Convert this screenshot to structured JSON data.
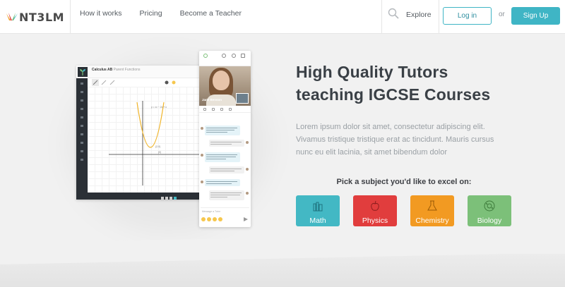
{
  "brand": {
    "logo_text": "NT3LM"
  },
  "nav": {
    "how_it_works": "How it works",
    "pricing": "Pricing",
    "become_teacher": "Become a Teacher"
  },
  "header_right": {
    "explore": "Explore",
    "login": "Log in",
    "or": "or",
    "signup": "Sign Up"
  },
  "mockup": {
    "whiteboard_title": "Calculus AB",
    "whiteboard_subtitle": "Parent Functions",
    "tutor_name": "Jane Benson",
    "message_placeholder": "Message a Tutor"
  },
  "hero": {
    "headline_line1": "High Quality Tutors",
    "headline_line2": "teaching IGCSE Courses",
    "description": "Lorem ipsum dolor sit amet, consectetur adipiscing elit. Vivamus tristique tristique erat ac tincidunt. Mauris cursus nunc eu elit lacinia, sit amet bibendum dolor",
    "pick_prompt": "Pick a subject you'd like to excel on:"
  },
  "subjects": [
    {
      "label": "Math",
      "color": "#43b8c4",
      "icon": "books-icon"
    },
    {
      "label": "Physics",
      "color": "#e13d3d",
      "icon": "apple-icon"
    },
    {
      "label": "Chemistry",
      "color": "#f29a22",
      "icon": "flask-icon"
    },
    {
      "label": "Biology",
      "color": "#7cc079",
      "icon": "cell-icon"
    }
  ],
  "colors": {
    "accent": "#3fb5c5",
    "background": "#f1f1f1",
    "text": "#3a4046"
  }
}
